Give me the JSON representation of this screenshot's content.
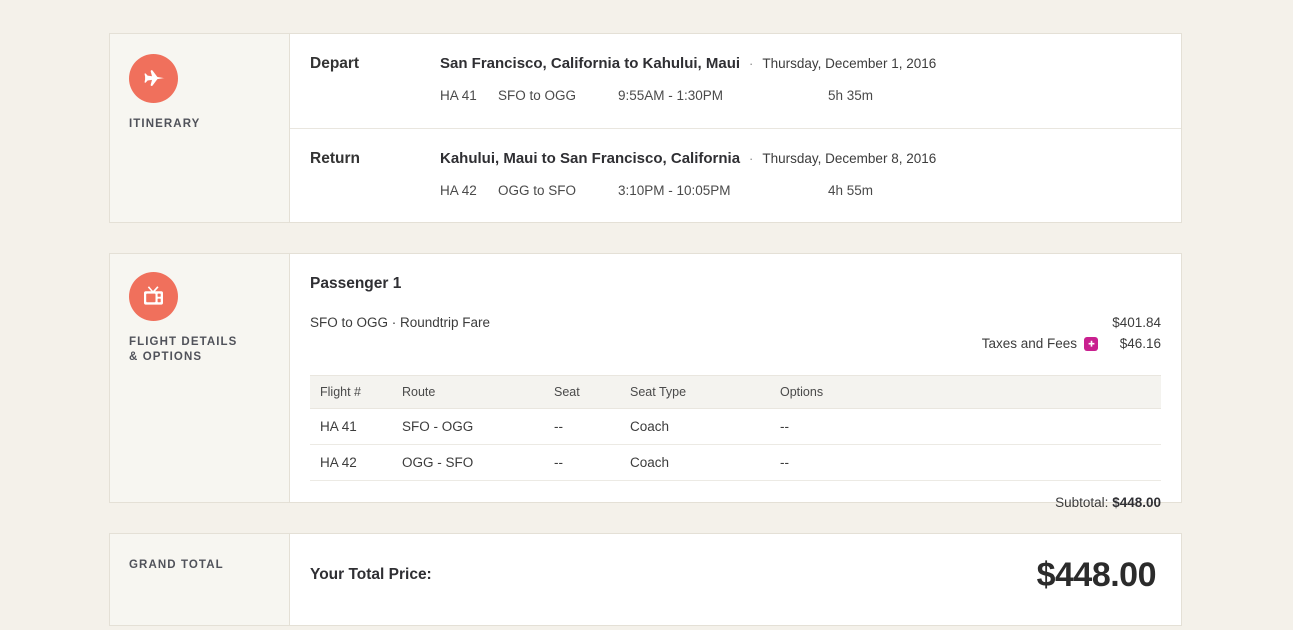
{
  "itinerary": {
    "aside_label": "ITINERARY",
    "icon": "airplane-icon",
    "accent_color": "#f0705c",
    "legs": [
      {
        "direction": "Depart",
        "route": "San Francisco, California to Kahului, Maui",
        "separator": "·",
        "date": "Thursday, December 1, 2016",
        "flight_number": "HA 41",
        "airport_pair": "SFO to OGG",
        "times": "9:55AM - 1:30PM",
        "duration": "5h 35m"
      },
      {
        "direction": "Return",
        "route": "Kahului, Maui to San Francisco, California",
        "separator": "·",
        "date": "Thursday, December 8, 2016",
        "flight_number": "HA 42",
        "airport_pair": "OGG to SFO",
        "times": "3:10PM - 10:05PM",
        "duration": "4h 55m"
      }
    ]
  },
  "flight_details": {
    "aside_label_line1": "FLIGHT DETAILS",
    "aside_label_line2": "& OPTIONS",
    "icon": "tv-icon",
    "passenger_title": "Passenger 1",
    "fare_description": "SFO to OGG · Roundtrip Fare",
    "fare_amount": "$401.84",
    "taxes_label": "Taxes and Fees",
    "taxes_badge_icon": "plus-badge-icon",
    "taxes_badge_color": "#c9208f",
    "taxes_amount": "$46.16",
    "table": {
      "columns": [
        "Flight #",
        "Route",
        "Seat",
        "Seat Type",
        "Options"
      ],
      "rows": [
        [
          "HA 41",
          "SFO - OGG",
          "--",
          "Coach",
          "--"
        ],
        [
          "HA 42",
          "OGG - SFO",
          "--",
          "Coach",
          "--"
        ]
      ]
    },
    "subtotal_label": "Subtotal:",
    "subtotal_amount": "$448.00"
  },
  "grand_total": {
    "aside_label": "GRAND TOTAL",
    "label": "Your Total Price:",
    "amount": "$448.00"
  }
}
